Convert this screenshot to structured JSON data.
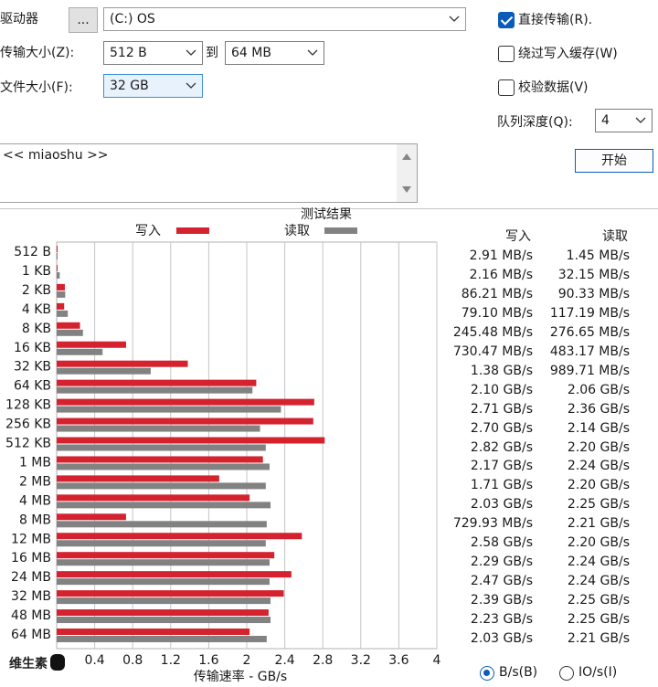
{
  "settings": {
    "drive_label": "驱动器",
    "drive_browse_label": "...",
    "drive_value": "(C:) OS",
    "transfer_size_label": "传输大小(Z):",
    "transfer_from": "512 B",
    "to_label": "到",
    "transfer_to": "64 MB",
    "file_size_label": "文件大小(F):",
    "file_size": "32 GB",
    "direct_io_label": "直接传输(R).",
    "direct_io_checked": true,
    "bypass_cache_label": "绕过写入缓存(W)",
    "bypass_cache_checked": false,
    "verify_label": "校验数据(V)",
    "verify_checked": false,
    "queue_depth_label": "队列深度(Q):",
    "queue_depth": "4",
    "start_label": "开始",
    "description": "<< miaoshu >>"
  },
  "colors": {
    "write": "#d4222f",
    "read": "#828282",
    "accent": "#0b5cb8"
  },
  "results": {
    "title": "测试结果",
    "write_header": "写入",
    "read_header": "读取",
    "rows": [
      {
        "size": "512 B",
        "write": "2.91 MB/s",
        "read": "1.45 MB/s"
      },
      {
        "size": "1 KB",
        "write": "2.16 MB/s",
        "read": "32.15 MB/s"
      },
      {
        "size": "2 KB",
        "write": "86.21 MB/s",
        "read": "90.33 MB/s"
      },
      {
        "size": "4 KB",
        "write": "79.10 MB/s",
        "read": "117.19 MB/s"
      },
      {
        "size": "8 KB",
        "write": "245.48 MB/s",
        "read": "276.65 MB/s"
      },
      {
        "size": "16 KB",
        "write": "730.47 MB/s",
        "read": "483.17 MB/s"
      },
      {
        "size": "32 KB",
        "write": "1.38 GB/s",
        "read": "989.71 MB/s"
      },
      {
        "size": "64 KB",
        "write": "2.10 GB/s",
        "read": "2.06 GB/s"
      },
      {
        "size": "128 KB",
        "write": "2.71 GB/s",
        "read": "2.36 GB/s"
      },
      {
        "size": "256 KB",
        "write": "2.70 GB/s",
        "read": "2.14 GB/s"
      },
      {
        "size": "512 KB",
        "write": "2.82 GB/s",
        "read": "2.20 GB/s"
      },
      {
        "size": "1 MB",
        "write": "2.17 GB/s",
        "read": "2.24 GB/s"
      },
      {
        "size": "2 MB",
        "write": "1.71 GB/s",
        "read": "2.20 GB/s"
      },
      {
        "size": "4 MB",
        "write": "2.03 GB/s",
        "read": "2.25 GB/s"
      },
      {
        "size": "8 MB",
        "write": "729.93 MB/s",
        "read": "2.21 GB/s"
      },
      {
        "size": "12 MB",
        "write": "2.58 GB/s",
        "read": "2.20 GB/s"
      },
      {
        "size": "16 MB",
        "write": "2.29 GB/s",
        "read": "2.24 GB/s"
      },
      {
        "size": "24 MB",
        "write": "2.47 GB/s",
        "read": "2.24 GB/s"
      },
      {
        "size": "32 MB",
        "write": "2.39 GB/s",
        "read": "2.25 GB/s"
      },
      {
        "size": "48 MB",
        "write": "2.23 GB/s",
        "read": "2.25 GB/s"
      },
      {
        "size": "64 MB",
        "write": "2.03 GB/s",
        "read": "2.21 GB/s"
      }
    ]
  },
  "chart_data": {
    "type": "bar",
    "orientation": "horizontal",
    "title": "测试结果",
    "xlabel": "传输速率 - GB/s",
    "xlim": [
      0,
      4
    ],
    "xticks": [
      "0.4",
      "0.8",
      "1.2",
      "1.6",
      "2",
      "2.4",
      "2.8",
      "3.2",
      "3.6",
      "4"
    ],
    "grid": true,
    "legend": "top",
    "categories": [
      "512 B",
      "1 KB",
      "2 KB",
      "4 KB",
      "8 KB",
      "16 KB",
      "32 KB",
      "64 KB",
      "128 KB",
      "256 KB",
      "512 KB",
      "1 MB",
      "2 MB",
      "4 MB",
      "8 MB",
      "12 MB",
      "16 MB",
      "24 MB",
      "32 MB",
      "48 MB",
      "64 MB"
    ],
    "series": [
      {
        "name": "写入",
        "values": [
          0.00291,
          0.00216,
          0.08621,
          0.0791,
          0.24548,
          0.73047,
          1.38,
          2.1,
          2.71,
          2.7,
          2.82,
          2.17,
          1.71,
          2.03,
          0.72993,
          2.58,
          2.29,
          2.47,
          2.39,
          2.23,
          2.03
        ]
      },
      {
        "name": "读取",
        "values": [
          0.00145,
          0.03215,
          0.09033,
          0.11719,
          0.27665,
          0.48317,
          0.98971,
          2.06,
          2.36,
          2.14,
          2.2,
          2.24,
          2.2,
          2.25,
          2.21,
          2.2,
          2.24,
          2.24,
          2.25,
          2.25,
          2.21
        ]
      }
    ]
  },
  "footer": {
    "logo_text": "维生素",
    "unit_bytes_label": "B/s(B)",
    "unit_io_label": "IO/s(I)",
    "unit_selected": "bytes"
  }
}
